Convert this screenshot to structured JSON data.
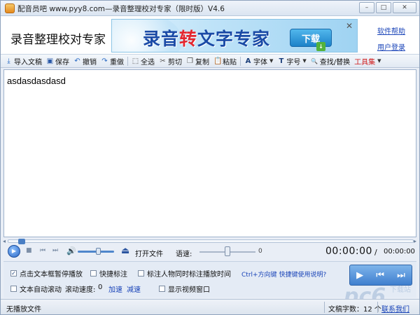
{
  "window": {
    "title": "配音员吧 www.pyy8.com—录音整理校对专家（限时版）V4.6",
    "min_glyph": "–",
    "max_glyph": "□",
    "close_glyph": "✕"
  },
  "header": {
    "app_name": "录音整理校对专家",
    "banner_text_a": "录音",
    "banner_text_hl": "转",
    "banner_text_b": "文字专家",
    "download_label": "下载",
    "download_badge": "↓",
    "banner_close": "✕",
    "links": [
      "软件帮助",
      "用户登录"
    ]
  },
  "toolbar": {
    "items": [
      {
        "icon": "import-icon",
        "glyph": "⤓",
        "label": "导入文稿"
      },
      {
        "icon": "save-icon",
        "glyph": "▣",
        "label": "保存"
      },
      {
        "icon": "undo-icon",
        "glyph": "↶",
        "label": "撤销"
      },
      {
        "icon": "redo-icon",
        "glyph": "↷",
        "label": "重做"
      },
      {
        "icon": "select-all-icon",
        "glyph": "⬚",
        "label": "全选"
      },
      {
        "icon": "cut-icon",
        "glyph": "✂",
        "label": "剪切"
      },
      {
        "icon": "copy-icon",
        "glyph": "❐",
        "label": "复制"
      },
      {
        "icon": "paste-icon",
        "glyph": "📋",
        "label": "粘贴"
      },
      {
        "icon": "font-icon",
        "glyph": "A",
        "label": "字体"
      },
      {
        "icon": "font-size-icon",
        "glyph": "T",
        "label": "字号"
      },
      {
        "icon": "find-replace-icon",
        "glyph": "🔍",
        "label": "查找/替换"
      },
      {
        "icon": "",
        "glyph": "",
        "label": "工具集"
      }
    ]
  },
  "editor": {
    "content": "asdasdasdasd"
  },
  "player": {
    "open_label": "打开文件",
    "speed_label": "语速:",
    "speed_value": "0",
    "time_current": "00:00:00",
    "time_separator": "/",
    "time_total": "00:00:00",
    "volume_level": 0.55,
    "speed_level": 0.5
  },
  "options": {
    "pause_on_click": {
      "label": "点击文本框暂停播放",
      "checked": true
    },
    "auto_scroll": {
      "label": "文本自动滚动",
      "checked": false
    },
    "quick_mark": {
      "label": "快捷标注",
      "checked": false
    },
    "mark_speaker_time": {
      "label": "标注人物同时标注播放时间",
      "checked": false
    },
    "show_video": {
      "label": "显示视频窗口",
      "checked": false
    },
    "scroll_speed_label": "滚动速度:",
    "scroll_speed_value": "0",
    "speed_up": "加速",
    "speed_down": "减速",
    "hotkey_text": "Ctrl+方向键",
    "hotkey_help": "快捷键使用说明?"
  },
  "status": {
    "left": "无播放文件",
    "word_count": "文稿字数：12 个",
    "contact": "联系我们"
  },
  "colors": {
    "accent": "#1a44b8",
    "banner_blue": "#1a4aa6",
    "banner_red": "#e3262f",
    "tool_red": "#d01c1c"
  }
}
